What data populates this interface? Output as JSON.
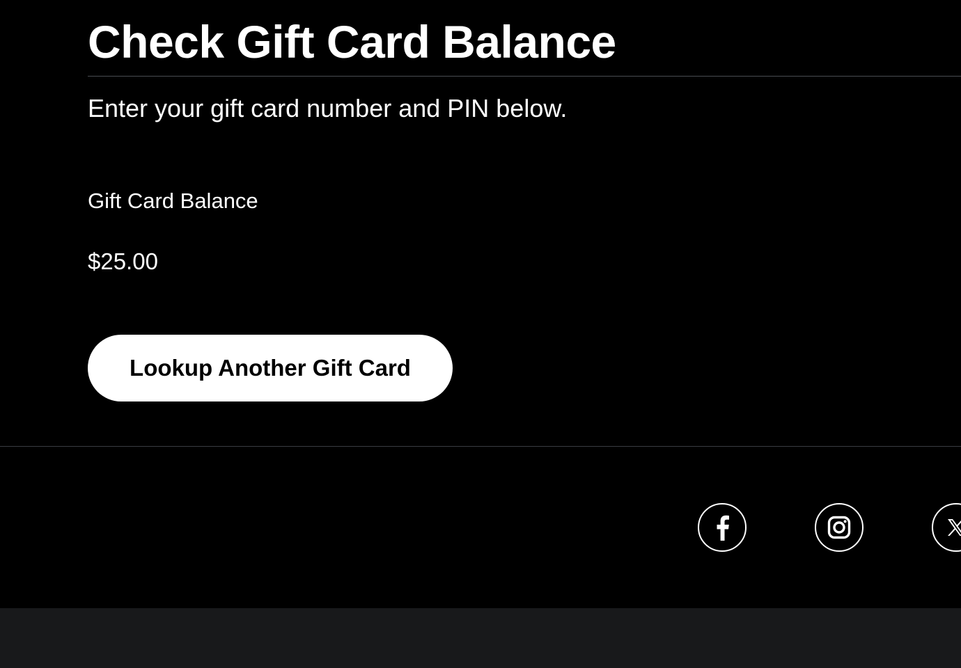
{
  "page": {
    "title": "Check Gift Card Balance",
    "subtitle": "Enter your gift card number and PIN below."
  },
  "balance": {
    "label": "Gift Card Balance",
    "value": "$25.00"
  },
  "actions": {
    "lookup_label": "Lookup Another Gift Card"
  },
  "footer": {
    "social_links": [
      {
        "name": "facebook",
        "icon": "facebook-icon"
      },
      {
        "name": "instagram",
        "icon": "instagram-icon"
      },
      {
        "name": "x",
        "icon": "x-icon"
      }
    ]
  },
  "colors": {
    "background": "#000000",
    "text": "#ffffff",
    "button_background": "#ffffff",
    "button_text": "#000000",
    "divider": "#4a4d52",
    "bottom_bar": "#18191b"
  }
}
